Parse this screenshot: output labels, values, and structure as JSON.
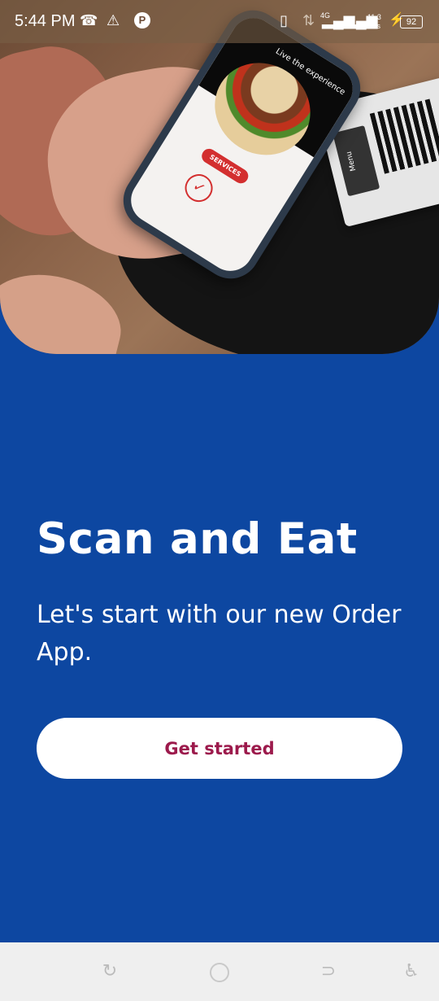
{
  "status_bar": {
    "time": "5:44 PM",
    "network_type": "4G",
    "data_speed_value": "11.3",
    "data_speed_unit": "K/s",
    "battery": "92",
    "icons": [
      "missed-call-icon",
      "warning-icon",
      "app-p-icon",
      "vibrate-icon",
      "data-arrows-icon",
      "signal-icon",
      "signal-icon-2",
      "charging-icon",
      "battery-icon"
    ]
  },
  "hero": {
    "phone_tagline": "Live the experience",
    "phone_button": "SERVICES",
    "qr_label": "Menu"
  },
  "onboarding": {
    "title": "Scan and Eat",
    "subtitle": "Let's start with our new Order App.",
    "cta_label": "Get started"
  },
  "colors": {
    "background": "#0d47a1",
    "button_bg": "#ffffff",
    "button_text": "#9c1a4c",
    "nav_bar": "#efefef"
  },
  "nav_bar": {
    "icons": [
      "recent-apps-icon",
      "home-icon",
      "back-icon",
      "accessibility-icon"
    ]
  }
}
